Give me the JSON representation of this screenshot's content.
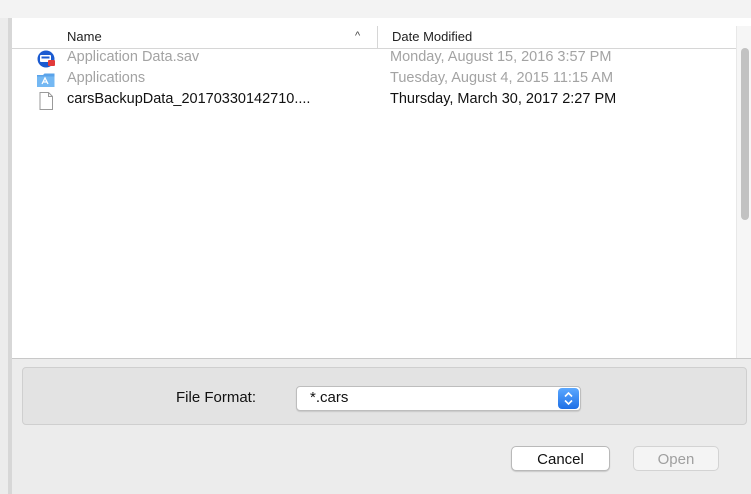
{
  "browser": {
    "columns": {
      "name": "Name",
      "date_modified": "Date Modified"
    },
    "sort_indicator": "^",
    "rows": [
      {
        "name": "Application Data.sav",
        "date_modified": "Monday, August 15, 2016 3:57 PM",
        "icon": "app-data-icon",
        "enabled": false
      },
      {
        "name": "Applications",
        "date_modified": "Tuesday, August 4, 2015 11:15 AM",
        "icon": "applications-folder-icon",
        "enabled": false
      },
      {
        "name": "carsBackupData_20170330142710....",
        "date_modified": "Thursday, March 30, 2017 2:27 PM",
        "icon": "document-icon",
        "enabled": true
      }
    ]
  },
  "format": {
    "label": "File Format:",
    "selected": "*.cars"
  },
  "buttons": {
    "cancel": "Cancel",
    "open": "Open"
  },
  "colors": {
    "accent": "#2f7ff0",
    "disabled_text": "#a3a3a3",
    "background": "#ececec"
  }
}
